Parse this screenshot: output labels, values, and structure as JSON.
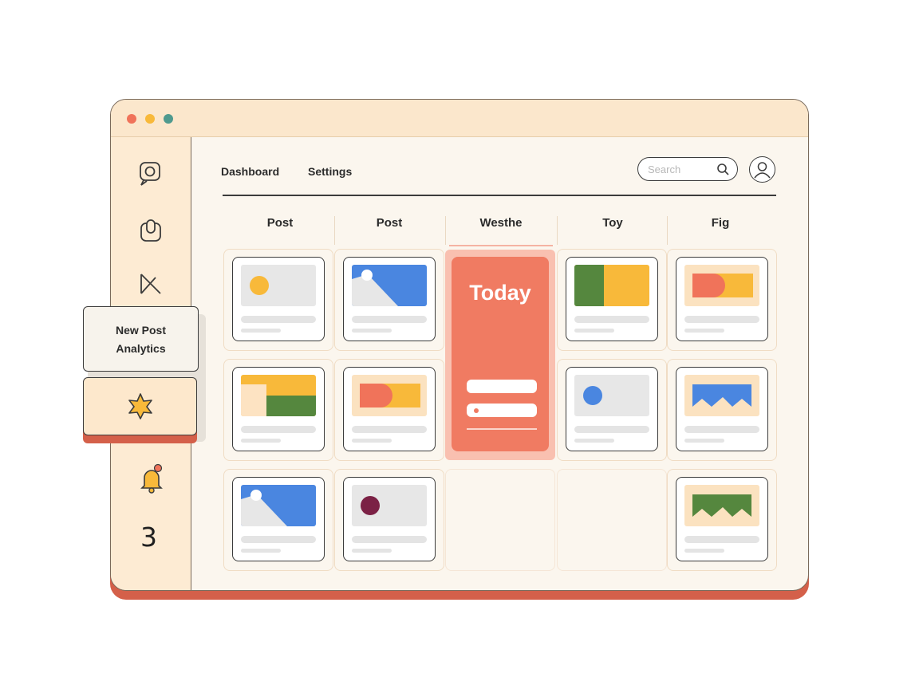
{
  "window": {
    "traffic_lights": [
      "#f0735a",
      "#f8b93a",
      "#4f9a8e"
    ]
  },
  "nav": {
    "links": [
      "Dashboard",
      "Settings"
    ],
    "search_placeholder": "Search"
  },
  "columns": [
    "Post",
    "Post",
    "Westhe",
    "Toy",
    "Fig"
  ],
  "today": {
    "title": "Today"
  },
  "popover": {
    "line1": "New Post",
    "line2": "Analytics"
  },
  "sidebar": {
    "icons": [
      "chat-bubble-icon",
      "mouse-icon",
      "send-icon",
      "star-icon",
      "bell-icon"
    ],
    "notification_count": "3"
  },
  "colors": {
    "accent": "#f07b62",
    "blue": "#4a86e0",
    "yellow": "#f8b93a",
    "green": "#55873e",
    "maroon": "#7b2145",
    "window_frame": "#d4604a"
  }
}
